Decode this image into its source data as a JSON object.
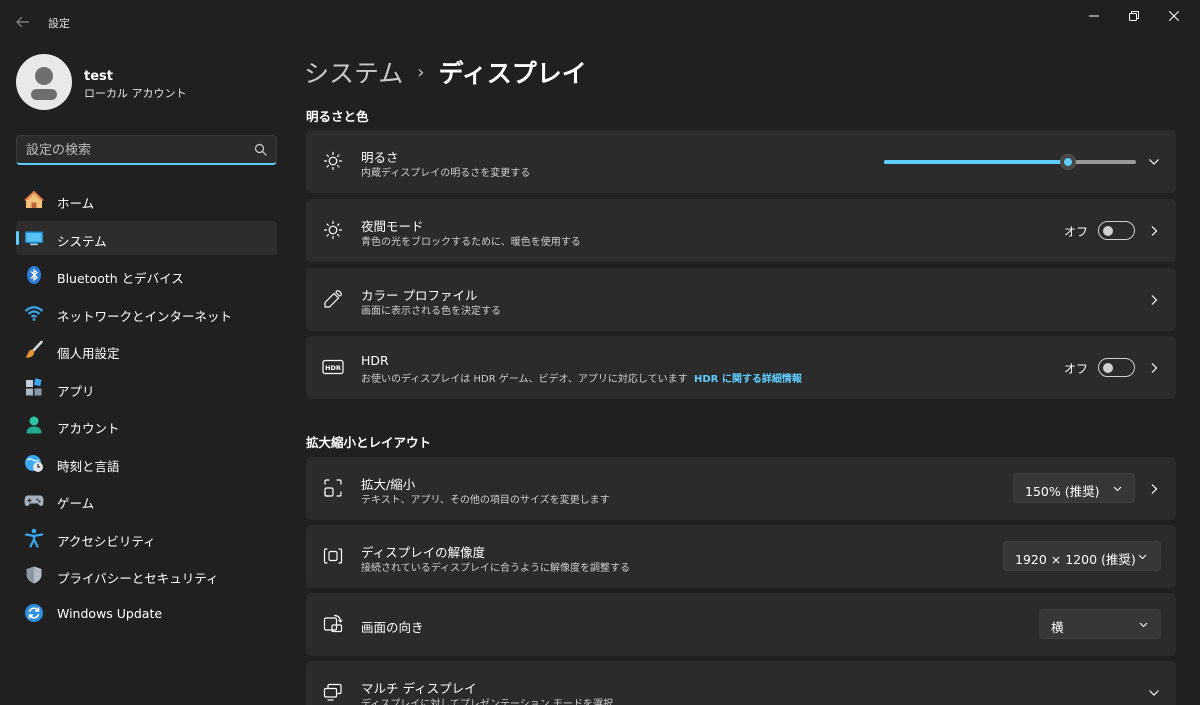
{
  "window": {
    "title": "設定"
  },
  "user": {
    "name": "test",
    "account_type": "ローカル アカウント"
  },
  "search": {
    "placeholder": "設定の検索"
  },
  "sidebar": {
    "items": [
      {
        "label": "ホーム",
        "icon": "home-icon"
      },
      {
        "label": "システム",
        "icon": "system-icon",
        "active": true
      },
      {
        "label": "Bluetooth とデバイス",
        "icon": "bluetooth-icon"
      },
      {
        "label": "ネットワークとインターネット",
        "icon": "wifi-icon"
      },
      {
        "label": "個人用設定",
        "icon": "brush-icon"
      },
      {
        "label": "アプリ",
        "icon": "apps-icon"
      },
      {
        "label": "アカウント",
        "icon": "account-icon"
      },
      {
        "label": "時刻と言語",
        "icon": "time-language-icon"
      },
      {
        "label": "ゲーム",
        "icon": "gamepad-icon"
      },
      {
        "label": "アクセシビリティ",
        "icon": "accessibility-icon"
      },
      {
        "label": "プライバシーとセキュリティ",
        "icon": "shield-icon"
      },
      {
        "label": "Windows Update",
        "icon": "update-icon"
      }
    ]
  },
  "breadcrumb": {
    "parent": "システム",
    "separator": "›",
    "current": "ディスプレイ"
  },
  "sections": {
    "brightness_color": "明るさと色",
    "scale_layout": "拡大縮小とレイアウト"
  },
  "cards": {
    "brightness": {
      "title": "明るさ",
      "desc": "内蔵ディスプレイの明るさを変更する",
      "value_fraction": 0.73
    },
    "night_light": {
      "title": "夜間モード",
      "desc": "青色の光をブロックするために、暖色を使用する",
      "toggle_label": "オフ"
    },
    "color_profile": {
      "title": "カラー プロファイル",
      "desc": "画面に表示される色を決定する"
    },
    "hdr": {
      "title": "HDR",
      "desc": "お使いのディスプレイは HDR ゲーム、ビデオ、アプリに対応しています",
      "link": "HDR に関する詳細情報",
      "toggle_label": "オフ"
    },
    "scale": {
      "title": "拡大/縮小",
      "desc": "テキスト、アプリ、その他の項目のサイズを変更します",
      "value": "150% (推奨)"
    },
    "resolution": {
      "title": "ディスプレイの解像度",
      "desc": "接続されているディスプレイに合うように解像度を調整する",
      "value": "1920 × 1200 (推奨)"
    },
    "orientation": {
      "title": "画面の向き",
      "value": "横"
    },
    "multi_display": {
      "title": "マルチ ディスプレイ",
      "desc": "ディスプレイに対してプレゼンテーション モードを選択"
    }
  },
  "colors": {
    "accent": "#60cdff",
    "background": "#202020",
    "card": "#2b2b2b"
  }
}
